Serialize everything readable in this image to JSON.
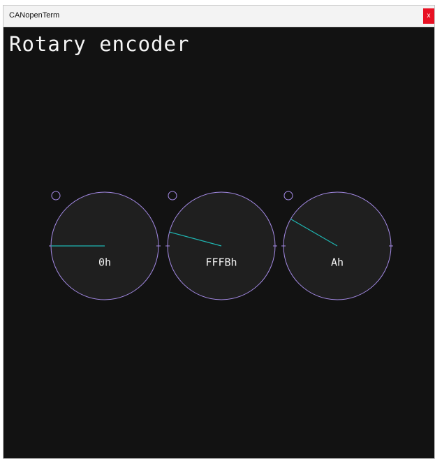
{
  "window": {
    "title": "CANopenTerm",
    "close_label": "x"
  },
  "screen": {
    "title": "Rotary encoder"
  },
  "colors": {
    "background": "#121212",
    "dial_fill": "#1f1f1f",
    "dial_outline": "#a58be7",
    "pointer": "#1fb7b3",
    "text": "#f2f2f2",
    "close_button": "#e81123"
  },
  "encoders": [
    {
      "label": "0h",
      "pointer_angle_deg": 180,
      "pointer_length_fraction": 1.0
    },
    {
      "label": "FFFBh",
      "pointer_angle_deg": 165,
      "pointer_length_fraction": 1.0
    },
    {
      "label": "Ah",
      "pointer_angle_deg": 150,
      "pointer_length_fraction": 1.0
    }
  ]
}
